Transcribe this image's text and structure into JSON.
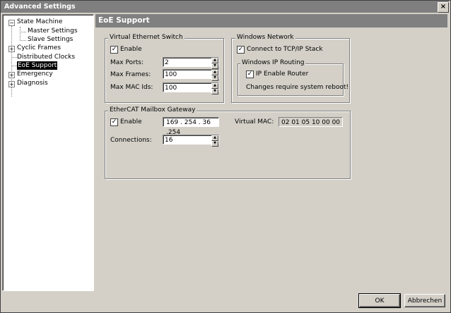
{
  "window": {
    "title": "Advanced Settings",
    "close_glyph": "×"
  },
  "tree": {
    "items": [
      {
        "label": "State Machine",
        "expander": "−"
      },
      {
        "label": "Master Settings"
      },
      {
        "label": "Slave Settings"
      },
      {
        "label": "Cyclic Frames",
        "expander": "+"
      },
      {
        "label": "Distributed Clocks"
      },
      {
        "label": "EoE Support",
        "selected": true
      },
      {
        "label": "Emergency",
        "expander": "+"
      },
      {
        "label": "Diagnosis",
        "expander": "+"
      }
    ]
  },
  "panel": {
    "title": "EoE Support"
  },
  "virtual_switch": {
    "legend": "Virtual Ethernet Switch",
    "enable_label": "Enable",
    "enable_checked": true,
    "max_ports_label": "Max Ports:",
    "max_ports": "2",
    "max_frames_label": "Max Frames:",
    "max_frames": "100",
    "max_mac_label": "Max MAC Ids:",
    "max_mac": "100"
  },
  "windows_network": {
    "legend": "Windows Network",
    "tcpip_label": "Connect to TCP/IP Stack",
    "tcpip_checked": true,
    "routing_legend": "Windows IP Routing",
    "ip_router_label": "IP Enable Router",
    "ip_router_checked": true,
    "reboot_note": "Changes require system reboot!"
  },
  "gateway": {
    "legend": "EtherCAT Mailbox Gateway",
    "enable_label": "Enable",
    "enable_checked": true,
    "ip": "169 . 254 . 36 .254",
    "virtual_mac_label": "Virtual MAC:",
    "virtual_mac": "02 01 05 10 00 00",
    "connections_label": "Connections:",
    "connections": "16"
  },
  "buttons": {
    "ok": "OK",
    "cancel": "Abbrechen"
  },
  "glyphs": {
    "check": "✓",
    "up": "▲",
    "down": "▼"
  }
}
